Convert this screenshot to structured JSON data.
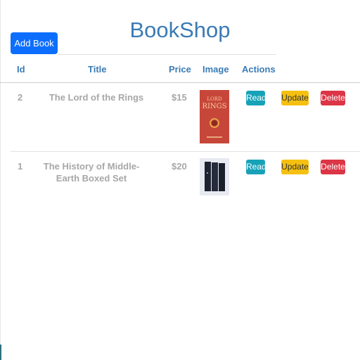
{
  "app": {
    "title": "BookShop"
  },
  "toolbar": {
    "add_label": "Add Book"
  },
  "table": {
    "headers": {
      "id": "Id",
      "title": "Title",
      "price": "Price",
      "image": "Image",
      "actions": "Actions"
    },
    "rows": [
      {
        "id": "2",
        "title": "The Lord of the Rings",
        "price": "$15",
        "cover": "lotr-cover"
      },
      {
        "id": "1",
        "title": "The History of Middle-Earth Boxed Set",
        "price": "$20",
        "cover": "boxed-set-cover"
      }
    ]
  },
  "actions": {
    "read": "Read",
    "update": "Update",
    "delete": "Delete"
  },
  "colors": {
    "primary": "#0d6efd",
    "title": "#3a7bb5",
    "read": "#17a2b8",
    "update": "#f5c00f",
    "delete": "#dc3545"
  }
}
